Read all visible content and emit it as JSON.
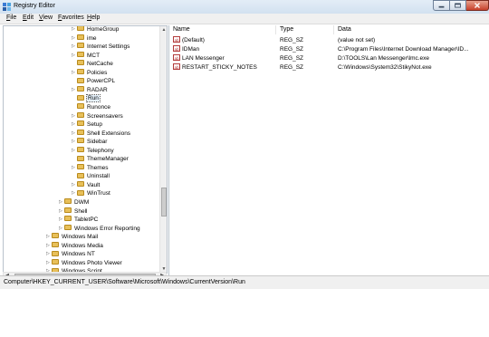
{
  "window": {
    "title": "Registry Editor"
  },
  "menu": [
    "File",
    "Edit",
    "View",
    "Favorites",
    "Help"
  ],
  "tree": [
    {
      "label": "HomeGroup",
      "level": 2,
      "expander": "closed"
    },
    {
      "label": "ime",
      "level": 2,
      "expander": "closed"
    },
    {
      "label": "Internet Settings",
      "level": 2,
      "expander": "closed"
    },
    {
      "label": "MCT",
      "level": 2,
      "expander": "closed"
    },
    {
      "label": "NetCache",
      "level": 2,
      "expander": "none"
    },
    {
      "label": "Policies",
      "level": 2,
      "expander": "closed"
    },
    {
      "label": "PowerCPL",
      "level": 2,
      "expander": "none"
    },
    {
      "label": "RADAR",
      "level": 2,
      "expander": "closed"
    },
    {
      "label": "Run",
      "level": 2,
      "expander": "none",
      "selected": true
    },
    {
      "label": "Runonce",
      "level": 2,
      "expander": "none"
    },
    {
      "label": "Screensavers",
      "level": 2,
      "expander": "closed"
    },
    {
      "label": "Setup",
      "level": 2,
      "expander": "closed"
    },
    {
      "label": "Shell Extensions",
      "level": 2,
      "expander": "closed"
    },
    {
      "label": "Sidebar",
      "level": 2,
      "expander": "closed"
    },
    {
      "label": "Telephony",
      "level": 2,
      "expander": "closed"
    },
    {
      "label": "ThemeManager",
      "level": 2,
      "expander": "none"
    },
    {
      "label": "Themes",
      "level": 2,
      "expander": "closed"
    },
    {
      "label": "Uninstall",
      "level": 2,
      "expander": "none"
    },
    {
      "label": "Vault",
      "level": 2,
      "expander": "closed"
    },
    {
      "label": "WinTrust",
      "level": 2,
      "expander": "closed"
    },
    {
      "label": "DWM",
      "level": 1,
      "expander": "closed"
    },
    {
      "label": "Shell",
      "level": 1,
      "expander": "closed"
    },
    {
      "label": "TabletPC",
      "level": 1,
      "expander": "closed"
    },
    {
      "label": "Windows Error Reporting",
      "level": 1,
      "expander": "closed"
    },
    {
      "label": "Windows Mail",
      "level": 0,
      "expander": "closed"
    },
    {
      "label": "Windows Media",
      "level": 0,
      "expander": "closed"
    },
    {
      "label": "Windows NT",
      "level": 0,
      "expander": "closed"
    },
    {
      "label": "Windows Photo Viewer",
      "level": 0,
      "expander": "closed"
    },
    {
      "label": "Windows Script",
      "level": 0,
      "expander": "closed"
    }
  ],
  "list": {
    "columns": [
      "Name",
      "Type",
      "Data"
    ],
    "rows": [
      {
        "icon": "string-value-icon",
        "name": "(Default)",
        "type": "REG_SZ",
        "data": "(value not set)"
      },
      {
        "icon": "string-value-icon",
        "name": "IDMan",
        "type": "REG_SZ",
        "data": "C:\\Program Files\\Internet Download Manager\\ID..."
      },
      {
        "icon": "string-value-icon",
        "name": "LAN Messenger",
        "type": "REG_SZ",
        "data": "D:\\TOOLS\\Lan Messenger\\lmc.exe"
      },
      {
        "icon": "string-value-icon",
        "name": "RESTART_STICKY_NOTES",
        "type": "REG_SZ",
        "data": "C:\\Windows\\System32\\StikyNot.exe"
      }
    ]
  },
  "status": {
    "path": "Computer\\HKEY_CURRENT_USER\\Software\\Microsoft\\Windows\\CurrentVersion\\Run"
  }
}
